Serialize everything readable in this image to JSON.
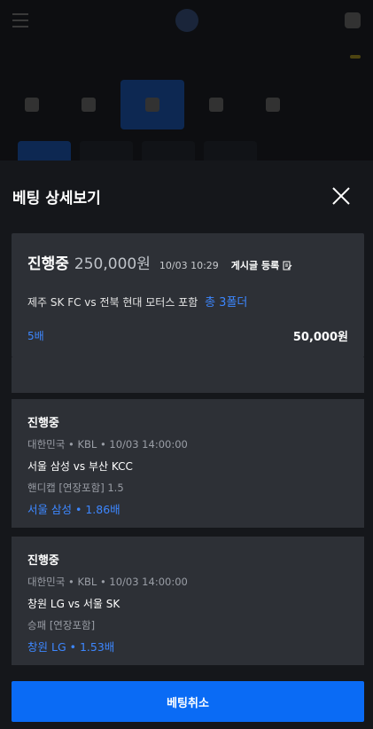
{
  "background": {
    "ticker_badge": ""
  },
  "sheet": {
    "title": "베팅 상세보기"
  },
  "summary": {
    "status": "진행중",
    "amount": "250,000원",
    "datetime": "10/03 10:29",
    "post_label": "게시글 등록",
    "match_title": "제주 SK FC vs 전북 현대 모터스 포함",
    "folder_count": "총 3폴더",
    "total_odds": "5배",
    "bet_amount": "50,000원"
  },
  "bets": [
    {
      "status": "진행중",
      "country": "대한민국",
      "league": "KBL",
      "datetime": "10/03 14:00:00",
      "teams": "서울 삼성 vs 부산 KCC",
      "market": "핸디캡 [연장포함] 1.5",
      "pick": "서울 삼성",
      "odds": "1.86배"
    },
    {
      "status": "진행중",
      "country": "대한민국",
      "league": "KBL",
      "datetime": "10/03 14:00:00",
      "teams": "창원 LG vs 서울 SK",
      "market": "승패 [연장포함]",
      "pick": "창원 LG",
      "odds": "1.53배"
    }
  ],
  "actions": {
    "cancel_label": "베팅취소"
  },
  "colors": {
    "accent": "#0a6bf5",
    "link_blue": "#3d87ff",
    "card_bg": "#2d3036",
    "sheet_bg": "#15171b"
  },
  "icons": [
    "close-icon",
    "document-edit-icon",
    "menu-icon",
    "bell-icon"
  ]
}
